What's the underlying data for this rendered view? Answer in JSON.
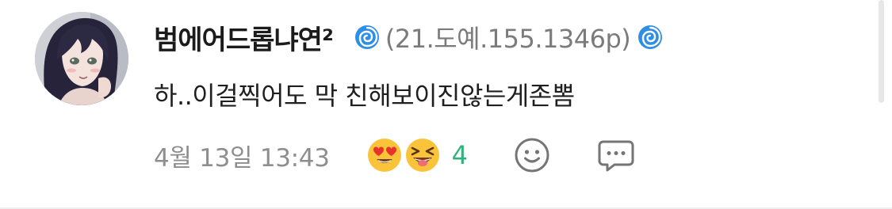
{
  "comment": {
    "author": {
      "nickname": "범에어드롭냐연²",
      "ip": "(21.도예.155.1346p)",
      "badge_icon": "cyclone-icon"
    },
    "text": "하..이걸찍어도 막 친해보이진않는게존뽐",
    "timestamp": "4월 13일 13:43",
    "reactions": {
      "emojis": [
        "heart-eyes-emoji",
        "squinting-tongue-emoji"
      ],
      "count": "4"
    },
    "actions": {
      "react_icon": "smiley-icon",
      "reply_icon": "speech-bubble-icon"
    }
  },
  "colors": {
    "nickname": "#1b1b1b",
    "ip": "#7b7b7b",
    "text": "#1f1f1f",
    "timestamp": "#8e8e8e",
    "reaction_count": "#2fb37a",
    "swirl": "#2f8ee6",
    "action_icon": "#757575"
  }
}
